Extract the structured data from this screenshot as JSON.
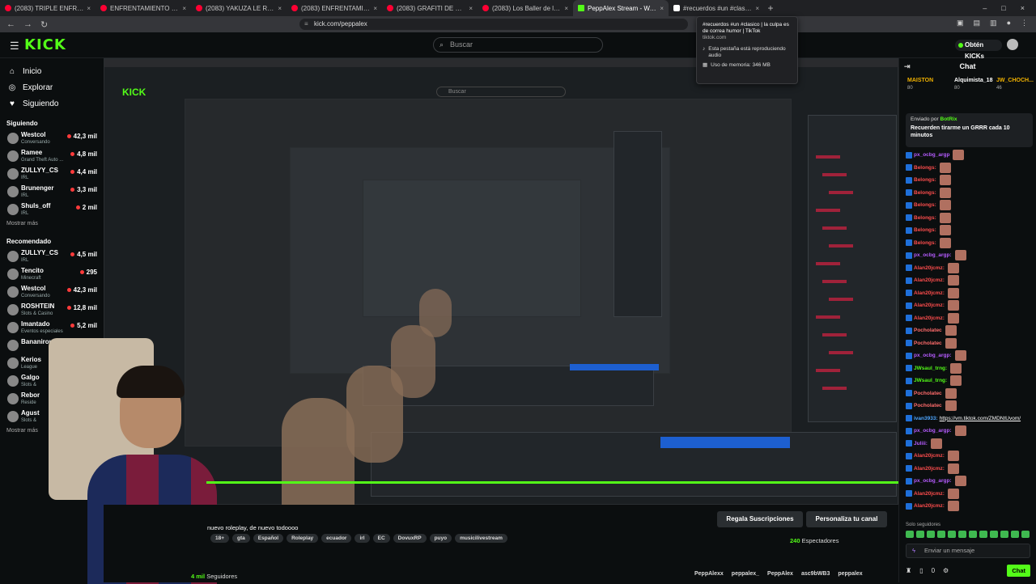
{
  "browser": {
    "tabs": [
      {
        "title": "(2083) TRIPLE ENFRENTAMIENTO NA",
        "kind": "youtube"
      },
      {
        "title": "ENFRENTAMIENTO NAMELEZ VS YO",
        "kind": "youtube"
      },
      {
        "title": "(2083) YAKUZA LE ROBAN A TEO Y S",
        "kind": "youtube"
      },
      {
        "title": "(2083) ENFRENTAMIENTO NAMELEZ",
        "kind": "youtube"
      },
      {
        "title": "(2083) GRAFITI DE GUERRA NAMELE",
        "kind": "youtube"
      },
      {
        "title": "(2083) Los Baller de la City - Namele",
        "kind": "youtube"
      },
      {
        "title": "PeppAlex Stream - Watch Live o",
        "kind": "kick",
        "active": true
      },
      {
        "title": "#recuerdos #un #clasico | la",
        "kind": "tiktok"
      }
    ],
    "url": "kick.com/peppalex"
  },
  "tab_popup": {
    "title": "#recuerdos #un #clasico | la culpa es de correa humor | TikTok",
    "domain": "tiktok.com",
    "audio": "Esta pestaña está reproduciendo audio",
    "memory": "Uso de memoria: 346 MB"
  },
  "header": {
    "logo": "KICK",
    "search_placeholder": "Buscar",
    "get_kicks": "Obtén KICKs"
  },
  "sidebar": {
    "nav": [
      {
        "label": "Inicio",
        "icon": "⌂"
      },
      {
        "label": "Explorar",
        "icon": "◎"
      },
      {
        "label": "Siguiendo",
        "icon": "♥"
      }
    ],
    "following_title": "Siguiendo",
    "following": [
      {
        "name": "Westcol",
        "category": "Conversando",
        "viewers": "42,3 mil"
      },
      {
        "name": "Ramee",
        "category": "Grand Theft Auto ...",
        "viewers": "4,8 mil"
      },
      {
        "name": "ZULLYY_CS",
        "category": "IRL",
        "viewers": "4,4 mil"
      },
      {
        "name": "Brunenger",
        "category": "IRL",
        "viewers": "3,3 mil"
      },
      {
        "name": "Shuls_off",
        "category": "IRL",
        "viewers": "2 mil"
      }
    ],
    "show_more": "Mostrar más",
    "recommended_title": "Recomendado",
    "recommended": [
      {
        "name": "ZULLYY_CS",
        "category": "IRL",
        "viewers": "4,5 mil"
      },
      {
        "name": "Tencito",
        "category": "Minecraft",
        "viewers": "295"
      },
      {
        "name": "Westcol",
        "category": "Conversando",
        "viewers": "42,3 mil"
      },
      {
        "name": "ROSHTEIN",
        "category": "Slots & Casino",
        "viewers": "12,8 mil"
      },
      {
        "name": "Imantado",
        "category": "Eventos especiales",
        "viewers": "5,2 mil"
      },
      {
        "name": "Bananirou",
        "category": "",
        "viewers": ""
      },
      {
        "name": "Kerios",
        "category": "League",
        "viewers": ""
      },
      {
        "name": "Galgo",
        "category": "Slots &",
        "viewers": ""
      },
      {
        "name": "Rebor",
        "category": "Reside",
        "viewers": ""
      },
      {
        "name": "Agust",
        "category": "Slots &",
        "viewers": ""
      }
    ],
    "show_more_2": "Mostrar más"
  },
  "stream": {
    "title": "nuevo roleplay, de nuevo todoooo",
    "tags": [
      "18+",
      "gta",
      "Español",
      "Roleplay",
      "ecuador",
      "irl",
      "EC",
      "DovuxRP",
      "puyo",
      "musicilivestream"
    ],
    "gift_button": "Regala Suscripciones",
    "customize_button": "Personaliza tu canal",
    "viewers": "240",
    "viewers_label": "Espectadores",
    "followers": "4 mil",
    "followers_label": "Seguidores",
    "socials": [
      "PeppAlexx",
      "peppalex_",
      "PeppAlex",
      "asc9bWB3",
      "peppalex"
    ]
  },
  "chat": {
    "title": "Chat",
    "gifters": [
      {
        "name": "MAISTON",
        "count": "80",
        "color": "#f0b100"
      },
      {
        "name": "Alquimista_18",
        "count": "80",
        "color": "#ffffff"
      },
      {
        "name": "JW_CHOCH...",
        "count": "46",
        "color": "#f0b100"
      }
    ],
    "pinned_by": "Enviado por",
    "pinned_user": "BotRix",
    "pinned_message": "Recuerden tirarme un GRRR cada 10 minutos",
    "messages": [
      {
        "user": "px_ocbg_argp",
        "color": "#b65cff"
      },
      {
        "user": "Belongs:",
        "color": "#ff4d4d"
      },
      {
        "user": "Belongs:",
        "color": "#ff4d4d"
      },
      {
        "user": "Belongs:",
        "color": "#ff4d4d"
      },
      {
        "user": "Belongs:",
        "color": "#ff4d4d"
      },
      {
        "user": "Belongs:",
        "color": "#ff4d4d"
      },
      {
        "user": "Belongs:",
        "color": "#ff4d4d"
      },
      {
        "user": "Belongs:",
        "color": "#ff4d4d"
      },
      {
        "user": "px_ocbg_argp:",
        "color": "#b65cff"
      },
      {
        "user": "Alan20jcmz:",
        "color": "#ff4d4d"
      },
      {
        "user": "Alan20jcmz:",
        "color": "#ff4d4d"
      },
      {
        "user": "Alan20jcmz:",
        "color": "#ff4d4d"
      },
      {
        "user": "Alan20jcmz:",
        "color": "#ff4d4d"
      },
      {
        "user": "Alan20jcmz:",
        "color": "#ff4d4d"
      },
      {
        "user": "Pocholatec",
        "color": "#ff6b6b"
      },
      {
        "user": "Pocholatec",
        "color": "#ff6b6b"
      },
      {
        "user": "px_ocbg_argp:",
        "color": "#b65cff"
      },
      {
        "user": "JWsaul_trng:",
        "color": "#53fc18"
      },
      {
        "user": "JWsaul_trng:",
        "color": "#53fc18"
      },
      {
        "user": "Pocholatec",
        "color": "#ff6b6b"
      },
      {
        "user": "Pocholatec",
        "color": "#ff6b6b"
      },
      {
        "user": "ivan3933:",
        "color": "#4da6ff",
        "link": "https://vm.tiktok.com/ZMDNtUvom/"
      },
      {
        "user": "px_ocbg_argp:",
        "color": "#b65cff"
      },
      {
        "user": "Juliii:",
        "color": "#b65cff"
      },
      {
        "user": "Alan20jcmz:",
        "color": "#ff4d4d"
      },
      {
        "user": "Alan20jcmz:",
        "color": "#ff4d4d"
      },
      {
        "user": "px_ocbg_argp:",
        "color": "#b65cff"
      },
      {
        "user": "Alan20jcmz:",
        "color": "#ff4d4d"
      },
      {
        "user": "Alan20jcmz:",
        "color": "#ff4d4d"
      }
    ],
    "followers_only": "Solo seguidores",
    "input_placeholder": "Enviar un mensaje",
    "kicks_count": "0",
    "send_label": "Chat"
  }
}
